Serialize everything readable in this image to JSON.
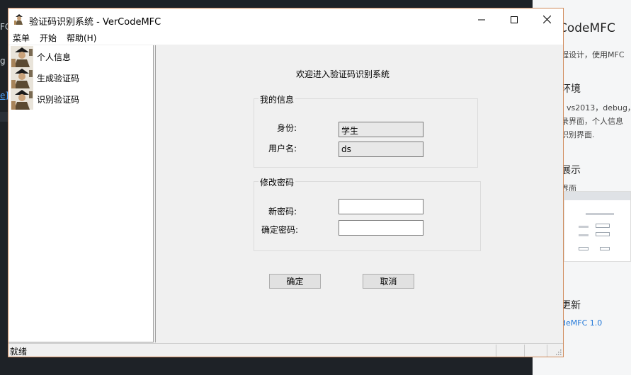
{
  "window": {
    "title": "验证码识别系统 - VerCodeMFC"
  },
  "menubar": {
    "items": [
      "菜单",
      "开始",
      "帮助(H)"
    ]
  },
  "tree": {
    "items": [
      {
        "label": "个人信息",
        "icon": "user-avatar-icon"
      },
      {
        "label": "生成验证码",
        "icon": "user-avatar-icon"
      },
      {
        "label": "识别验证码",
        "icon": "user-avatar-icon"
      }
    ]
  },
  "main": {
    "welcome": "欢迎进入验证码识别系统",
    "my_info": {
      "legend": "我的信息",
      "role_label": "身份:",
      "role_value": "学生",
      "username_label": "用户名:",
      "username_value": "ds"
    },
    "change_password": {
      "legend": "修改密码",
      "new_password_label": "新密码:",
      "new_password_value": "",
      "confirm_password_label": "确定密码:",
      "confirm_password_value": ""
    },
    "confirm_button": "确定",
    "cancel_button": "取消"
  },
  "statusbar": {
    "text": "就绪"
  },
  "background_left": {
    "fragments": [
      "FC",
      "g",
      "e]("
    ]
  },
  "background_right": {
    "title": "CodeMFC",
    "intro": "程设计，使用MFC",
    "env_heading": "环境",
    "env_text": "vs2013，debug，",
    "env_text2": "录界面，个人信息",
    "env_text3": "识别界面.",
    "demo_heading": "展示",
    "demo_sub": "界面",
    "update_heading": "更新",
    "update_link": "deMFC  1.0"
  },
  "colors": {
    "window_border": "#d08a5a",
    "link": "#2378d8",
    "editor_bg": "#1e2227"
  }
}
